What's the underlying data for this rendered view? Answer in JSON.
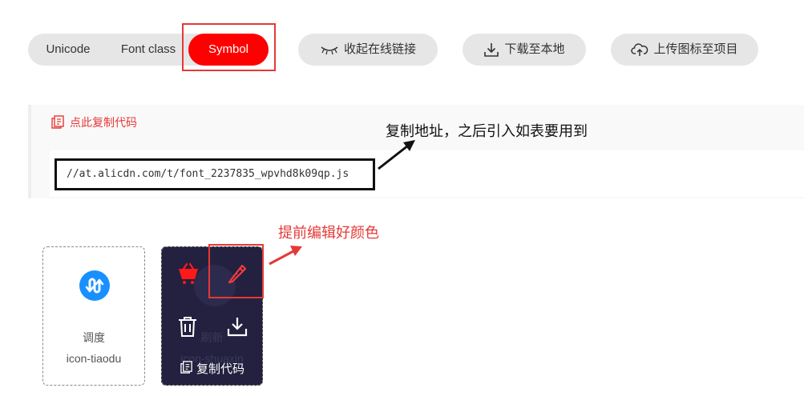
{
  "tabs": [
    {
      "label": "Unicode",
      "active": false
    },
    {
      "label": "Font class",
      "active": false
    },
    {
      "label": "Symbol",
      "active": true
    }
  ],
  "actions": {
    "collapse_label": "收起在线链接",
    "download_label": "下载至本地",
    "upload_label": "上传图标至项目"
  },
  "code": {
    "copy_label": "点此复制代码",
    "url": "//at.alicdn.com/t/font_2237835_wpvhd8k09qp.js"
  },
  "annotations": {
    "url_note": "复制地址，之后引入如表要用到",
    "edit_note": "提前编辑好颜色"
  },
  "icons": [
    {
      "name": "调度",
      "class": "icon-tiaodu",
      "icon": "tiaodu-icon",
      "color": "#1890ff"
    },
    {
      "name": "刷新",
      "class": "icon-shuaxin",
      "hover": true,
      "actions": [
        "cart-icon",
        "edit-icon",
        "delete-icon",
        "download-icon"
      ],
      "copy_label": "复制代码"
    }
  ],
  "colors": {
    "accent": "#ff0000",
    "annotation_red": "#e53935",
    "hover_card_bg": "#23213f",
    "pill_bg": "#e6e6e6"
  }
}
